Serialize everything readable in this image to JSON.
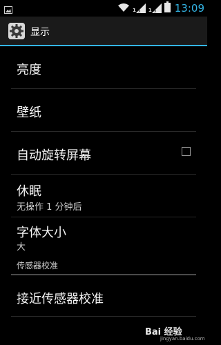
{
  "status_bar": {
    "time": "13:09",
    "icons": [
      "image-notification-icon",
      "wifi-icon",
      "signal-icon",
      "signal-icon",
      "battery-icon"
    ],
    "net_badge_1": "1",
    "net_badge_2": "1"
  },
  "action_bar": {
    "title": "显示",
    "icon": "settings-gear-icon"
  },
  "list": {
    "items": [
      {
        "title": "亮度"
      },
      {
        "title": "壁纸"
      },
      {
        "title": "自动旋转屏幕",
        "checked": false
      },
      {
        "title": "休眠",
        "summary": "无操作 1 分钟后"
      },
      {
        "title": "字体大小",
        "summary": "大"
      }
    ],
    "section_header": "传感器校准",
    "sensor_item": {
      "title": "接近传感器校准"
    }
  },
  "watermark": {
    "logo": "Bai 经验",
    "url": "jingyan.baidu.com"
  },
  "colors": {
    "accent": "#33b5e5",
    "background": "#000000"
  }
}
